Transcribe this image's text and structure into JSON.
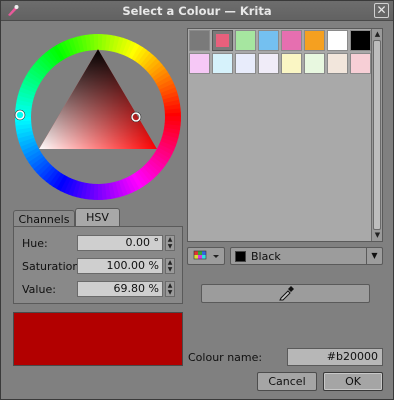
{
  "window": {
    "title": "Select a Colour — Krita",
    "close_glyph": "✕",
    "app_icon": "krita-icon"
  },
  "selector": {
    "hue_icon": "hue-ring",
    "triangle_icon": "sv-triangle"
  },
  "tabs": [
    {
      "label": "Channels"
    },
    {
      "label": "HSV"
    }
  ],
  "channels": [
    {
      "label": "Hue:",
      "value": "0.00 °"
    },
    {
      "label": "Saturation:",
      "value": "100.00 %"
    },
    {
      "label": "Value:",
      "value": "69.80 %"
    }
  ],
  "current_color": "#b20000",
  "palette": {
    "row1": [
      "#7a7a7a",
      "#e8607c",
      "#a6e6a0",
      "#74c0f0",
      "#e66fb0",
      "#f5a020",
      "#ffffff",
      "#000000"
    ],
    "row2": [
      "#f6c8f6",
      "#d6f2fb",
      "#e8ecfb",
      "#f0ecf8",
      "#faf6c4",
      "#e8f8e0",
      "#f2e6dc",
      "#f7cfd6"
    ],
    "selected_index": 1
  },
  "palette_list": {
    "selected": "Black",
    "chip_color": "#000000"
  },
  "picker_icon": "eyedropper-icon",
  "colour_name": {
    "label": "Colour name:",
    "value": "#b20000"
  },
  "buttons": {
    "cancel": "Cancel",
    "ok": "OK"
  }
}
